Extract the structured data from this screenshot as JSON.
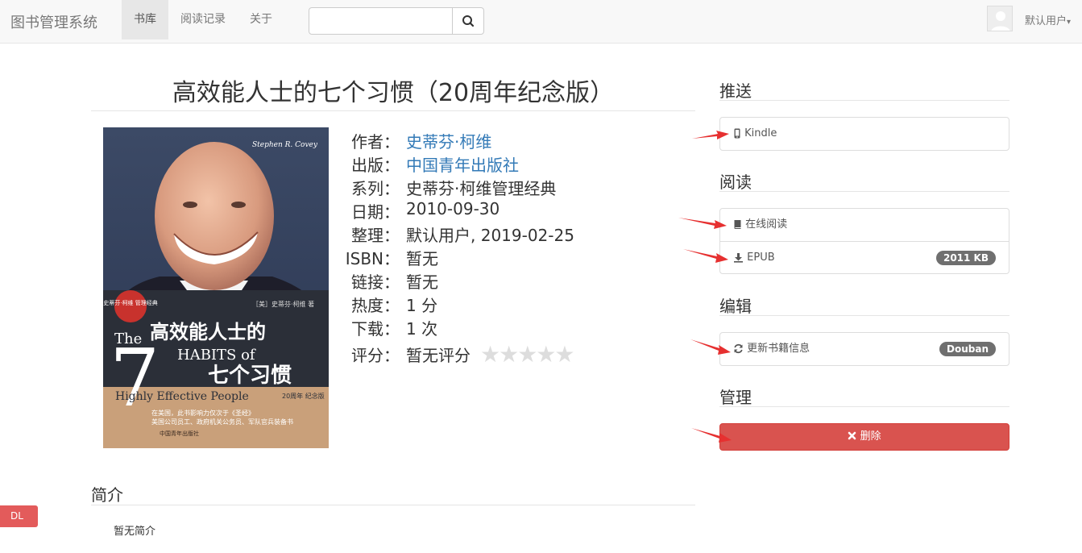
{
  "navbar": {
    "brand": "图书管理系统",
    "tabs": [
      {
        "label": "书库",
        "active": true
      },
      {
        "label": "阅读记录",
        "active": false
      },
      {
        "label": "关于",
        "active": false
      }
    ],
    "search": {
      "placeholder": "",
      "icon": "search-icon"
    },
    "user": {
      "name": "默认用户",
      "caret": "▾"
    }
  },
  "book": {
    "title": "高效能人士的七个习惯（20周年纪念版）",
    "cover": {
      "author_script": "Stephen R. Covey",
      "badge": "史蒂芬·柯维 管理经典",
      "author_cn": "［美］史蒂芬·柯维 著",
      "title_cn_1": "高效能人士的",
      "title_cn_2": "七个习惯",
      "the": "The",
      "number": "7",
      "habits_of": "HABITS of",
      "highly": "Highly Effective People",
      "edition": "20周年 纪念版",
      "tagline_1": "在美国，此书影响力仅次于《圣经》",
      "tagline_2": "美国公司员工、政府机关公务员、军队官兵装备书",
      "publisher_mark": "中国青年出版社"
    },
    "meta": [
      {
        "key": "作者：",
        "value": "史蒂芬·柯维",
        "link": true
      },
      {
        "key": "出版：",
        "value": "中国青年出版社",
        "link": true
      },
      {
        "key": "系列：",
        "value": "史蒂芬·柯维管理经典",
        "link": false
      },
      {
        "key": "日期：",
        "value": "2010-09-30",
        "link": false
      },
      {
        "key": "整理：",
        "value": "默认用户, 2019-02-25",
        "link": false
      },
      {
        "key": "ISBN：",
        "value": "暂无",
        "link": false
      },
      {
        "key": "链接：",
        "value": "暂无",
        "link": false
      },
      {
        "key": "热度：",
        "value": "1 分",
        "link": false
      },
      {
        "key": "下载：",
        "value": "1 次",
        "link": false
      },
      {
        "key": "评分：",
        "value": "暂无评分",
        "link": false
      }
    ],
    "stars": "★★★★★"
  },
  "sidebar": {
    "push": {
      "heading": "推送",
      "kindle": "Kindle"
    },
    "read": {
      "heading": "阅读",
      "online": "在线阅读",
      "epub": "EPUB",
      "epub_size": "2011 KB"
    },
    "edit": {
      "heading": "编辑",
      "update": "更新书籍信息",
      "source": "Douban"
    },
    "manage": {
      "heading": "管理",
      "delete": "删除"
    }
  },
  "intro": {
    "heading": "简介",
    "text": "暂无简介"
  },
  "dl_tab": "DL",
  "colors": {
    "danger": "#d9534f",
    "link": "#337ab7",
    "arrow": "#e63030",
    "badge": "#777777"
  }
}
